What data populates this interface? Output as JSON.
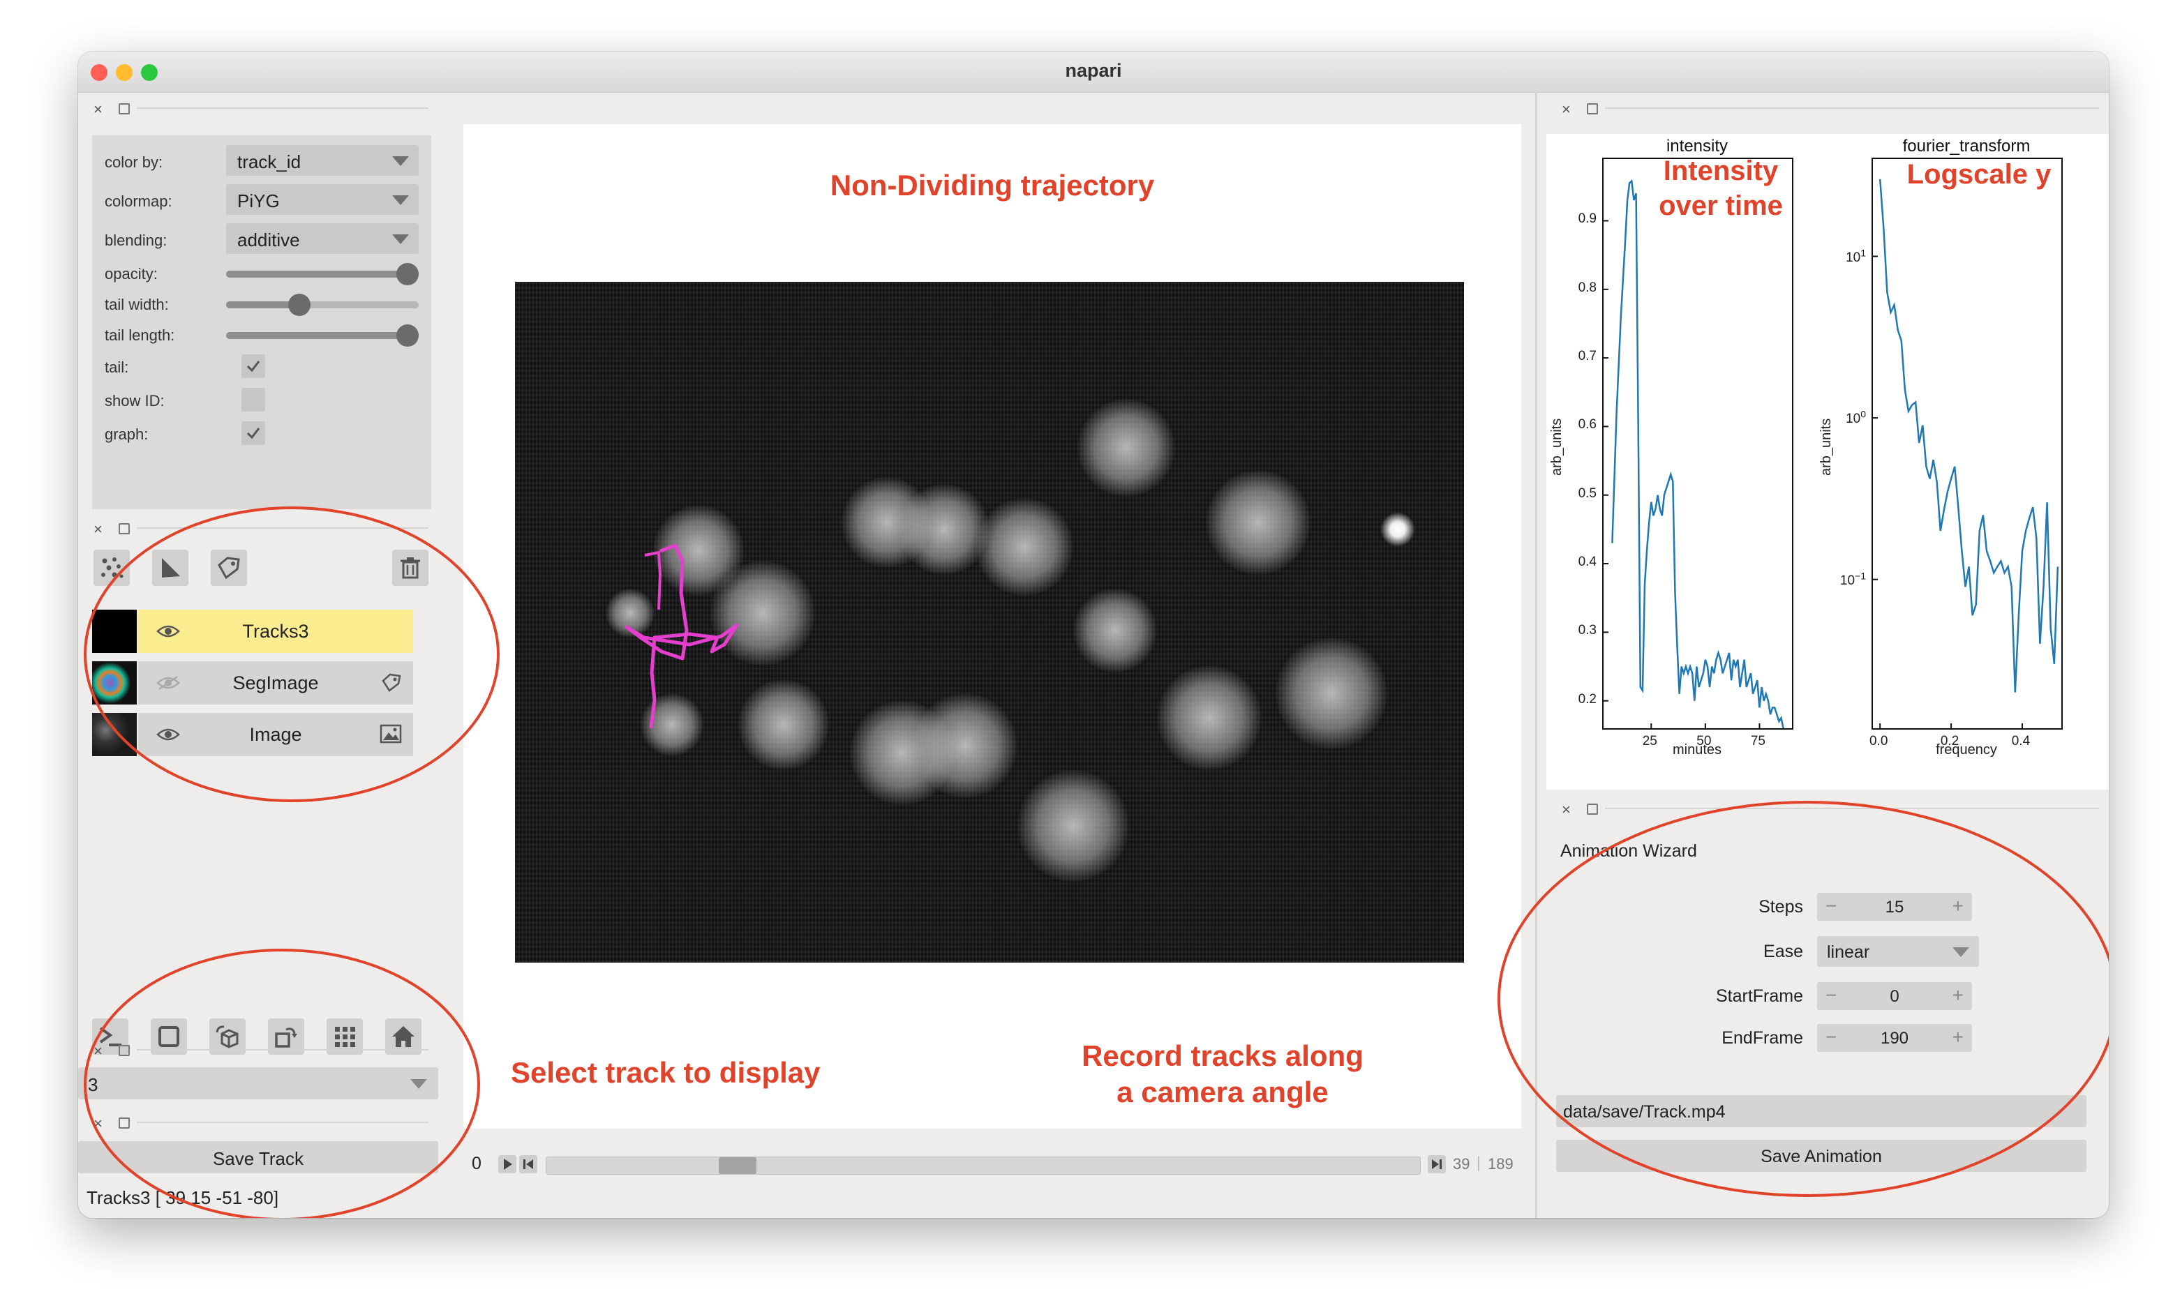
{
  "window": {
    "title": "napari"
  },
  "layer_controls": {
    "color_by": {
      "label": "color by:",
      "value": "track_id"
    },
    "colormap": {
      "label": "colormap:",
      "value": "PiYG"
    },
    "blending": {
      "label": "blending:",
      "value": "additive"
    },
    "opacity": {
      "label": "opacity:",
      "value": 1.0
    },
    "tail_width": {
      "label": "tail width:",
      "value": 0.38
    },
    "tail_length": {
      "label": "tail length:",
      "value": 1.0
    },
    "tail": {
      "label": "tail:",
      "checked": true
    },
    "show_id": {
      "label": "show ID:",
      "checked": false
    },
    "graph": {
      "label": "graph:",
      "checked": true
    }
  },
  "layer_buttons": [
    "new-points-icon",
    "new-shapes-icon",
    "new-labels-icon",
    "delete-layer-icon"
  ],
  "layers": [
    {
      "name": "Tracks3",
      "visible": true,
      "selected": true,
      "type_icon": "tracks-icon"
    },
    {
      "name": "SegImage",
      "visible": false,
      "selected": false,
      "type_icon": "labels-icon"
    },
    {
      "name": "Image",
      "visible": true,
      "selected": false,
      "type_icon": "image-icon"
    }
  ],
  "viewer_buttons": [
    "console-icon",
    "ndisplay-2d-icon",
    "roll-dims-icon",
    "transpose-icon",
    "grid-icon",
    "home-icon"
  ],
  "track_selector": {
    "value": "3"
  },
  "save_track": {
    "label": "Save Track"
  },
  "status_bar": {
    "text": "Tracks3 [ 39 15 -51 -80]"
  },
  "canvas": {
    "annotations": {
      "top": "Non-Dividing trajectory",
      "bottom_left": "Select track to display",
      "bottom_right_line1": "Record tracks along",
      "bottom_right_line2": "a camera angle"
    }
  },
  "dims_slider": {
    "axis_label": "0",
    "current": "39",
    "max": "189",
    "position": 0.206
  },
  "plots": {
    "annotation_left_line1": "Intensity",
    "annotation_left_line2": "over time",
    "annotation_right": "Logscale y"
  },
  "chart_data": [
    {
      "type": "line",
      "title": "intensity",
      "xlabel": "minutes",
      "ylabel": "arb_units",
      "xticks": [
        "25",
        "50",
        "75"
      ],
      "yticks": [
        "0.2",
        "0.3",
        "0.4",
        "0.5",
        "0.6",
        "0.7",
        "0.8",
        "0.9"
      ],
      "xlim": [
        3,
        90
      ],
      "ylim": [
        0.16,
        0.99
      ],
      "color": "#1f77b4",
      "x": [
        7,
        9,
        11,
        13,
        14,
        15,
        16,
        17,
        18,
        19,
        20,
        21,
        22,
        23,
        24,
        25,
        26,
        27,
        28,
        29,
        30,
        31,
        32,
        33,
        34,
        35,
        36,
        37,
        38,
        39,
        40,
        41,
        42,
        43,
        44,
        45,
        46,
        47,
        48,
        49,
        50,
        51,
        52,
        53,
        54,
        55,
        56,
        57,
        58,
        59,
        60,
        61,
        62,
        63,
        64,
        65,
        66,
        67,
        68,
        69,
        70,
        71,
        72,
        73,
        74,
        75,
        76,
        77,
        78,
        79,
        80,
        81,
        82,
        83,
        84,
        85,
        86
      ],
      "y": [
        0.43,
        0.62,
        0.76,
        0.87,
        0.93,
        0.955,
        0.958,
        0.93,
        0.94,
        0.6,
        0.22,
        0.215,
        0.37,
        0.42,
        0.46,
        0.49,
        0.47,
        0.48,
        0.5,
        0.48,
        0.47,
        0.5,
        0.51,
        0.52,
        0.53,
        0.52,
        0.36,
        0.28,
        0.21,
        0.25,
        0.24,
        0.25,
        0.24,
        0.25,
        0.24,
        0.2,
        0.25,
        0.22,
        0.23,
        0.24,
        0.26,
        0.25,
        0.22,
        0.25,
        0.24,
        0.26,
        0.27,
        0.26,
        0.24,
        0.25,
        0.26,
        0.27,
        0.23,
        0.26,
        0.25,
        0.26,
        0.22,
        0.24,
        0.26,
        0.22,
        0.23,
        0.24,
        0.21,
        0.22,
        0.23,
        0.19,
        0.22,
        0.2,
        0.21,
        0.2,
        0.18,
        0.19,
        0.19,
        0.18,
        0.17,
        0.175,
        0.16
      ]
    },
    {
      "type": "line",
      "title": "fourier_transform",
      "xlabel": "frequency",
      "ylabel": "arb_units",
      "log_y": true,
      "xticks": [
        "0.0",
        "0.2",
        "0.4"
      ],
      "yticks": [
        "10^1",
        "10^0",
        "10^-1"
      ],
      "xlim": [
        -0.02,
        0.51
      ],
      "ylim": [
        0.012,
        40
      ],
      "color": "#1f77b4",
      "x": [
        0,
        0.01,
        0.02,
        0.03,
        0.04,
        0.05,
        0.06,
        0.07,
        0.08,
        0.09,
        0.1,
        0.11,
        0.12,
        0.13,
        0.14,
        0.15,
        0.16,
        0.17,
        0.18,
        0.19,
        0.2,
        0.21,
        0.22,
        0.23,
        0.24,
        0.25,
        0.26,
        0.27,
        0.28,
        0.29,
        0.3,
        0.31,
        0.32,
        0.33,
        0.34,
        0.35,
        0.36,
        0.37,
        0.38,
        0.39,
        0.4,
        0.41,
        0.42,
        0.43,
        0.44,
        0.45,
        0.46,
        0.47,
        0.48,
        0.49,
        0.5
      ],
      "y": [
        30,
        15,
        6,
        4.5,
        5,
        3.5,
        3,
        1.5,
        1.1,
        1.2,
        1.25,
        0.7,
        0.9,
        0.5,
        0.42,
        0.55,
        0.4,
        0.2,
        0.27,
        0.35,
        0.42,
        0.5,
        0.28,
        0.15,
        0.09,
        0.12,
        0.06,
        0.07,
        0.2,
        0.25,
        0.15,
        0.13,
        0.11,
        0.12,
        0.13,
        0.11,
        0.12,
        0.09,
        0.02,
        0.06,
        0.15,
        0.2,
        0.24,
        0.28,
        0.18,
        0.04,
        0.09,
        0.3,
        0.05,
        0.03,
        0.12
      ]
    }
  ],
  "animation_wizard": {
    "title": "Animation Wizard",
    "steps": {
      "label": "Steps",
      "value": "15"
    },
    "ease": {
      "label": "Ease",
      "value": "linear"
    },
    "start_frame": {
      "label": "StartFrame",
      "value": "0"
    },
    "end_frame": {
      "label": "EndFrame",
      "value": "190"
    },
    "path": "data/save/Track.mp4",
    "save_button": "Save Animation"
  },
  "colors": {
    "annotation_red": "#e0432a",
    "selected_layer": "#fbec8f",
    "track_magenta": "#e43fcd",
    "plot_line": "#1f77b4"
  }
}
